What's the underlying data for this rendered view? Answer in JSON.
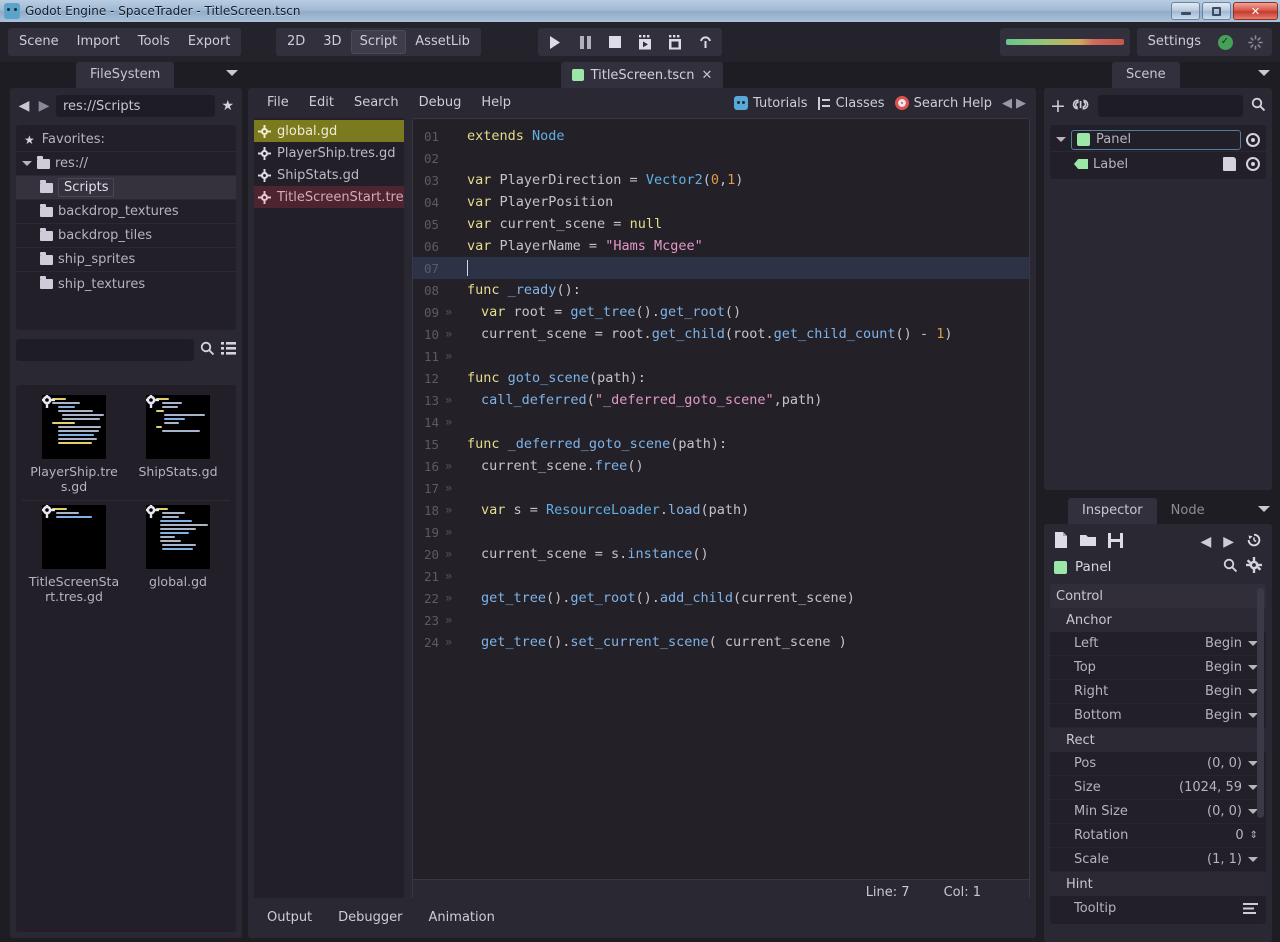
{
  "window": {
    "title": "Godot Engine - SpaceTrader - TitleScreen.tscn",
    "minimize_label": "Minimize",
    "restore_label": "Restore",
    "close_label": "✕"
  },
  "topbar": {
    "main_menu": [
      "Scene",
      "Import",
      "Tools",
      "Export"
    ],
    "mode_tabs": [
      {
        "label": "2D",
        "active": false
      },
      {
        "label": "3D",
        "active": false
      },
      {
        "label": "Script",
        "active": true
      },
      {
        "label": "AssetLib",
        "active": false
      }
    ],
    "playback": [
      {
        "name": "play-icon",
        "glyph": "▶"
      },
      {
        "name": "pause-icon",
        "glyph": "❙❙"
      },
      {
        "name": "stop-icon",
        "glyph": "■"
      },
      {
        "name": "play-scene-icon",
        "glyph": "▶"
      },
      {
        "name": "play-custom-scene-icon",
        "glyph": "▣"
      },
      {
        "name": "remote-debug-icon",
        "glyph": "⌖"
      }
    ],
    "settings_label": "Settings",
    "settings_status_glyph": "✓",
    "progress_colors": [
      "#68c68e",
      "#d1a95c",
      "#c5564b"
    ]
  },
  "filesystem": {
    "dock_title": "FileSystem",
    "path_value": "res://Scripts",
    "nav_back_glyph": "◀",
    "nav_forward_glyph": "▶",
    "favorite_glyph": "★",
    "tree": [
      {
        "label": "Favorites:",
        "kind": "favorites",
        "depth": 0
      },
      {
        "label": "res://",
        "kind": "folder",
        "depth": 0,
        "expanded": true
      },
      {
        "label": "Scripts",
        "kind": "folder",
        "depth": 1,
        "selected": true
      },
      {
        "label": "backdrop_textures",
        "kind": "folder",
        "depth": 1
      },
      {
        "label": "backdrop_tiles",
        "kind": "folder",
        "depth": 1
      },
      {
        "label": "ship_sprites",
        "kind": "folder",
        "depth": 1
      },
      {
        "label": "ship_textures",
        "kind": "folder",
        "depth": 1
      }
    ],
    "search_placeholder": "",
    "search_value": "",
    "files": [
      {
        "label": "PlayerShip.tres.gd"
      },
      {
        "label": "ShipStats.gd"
      },
      {
        "label": "TitleScreenStart.tres.gd"
      },
      {
        "label": "global.gd"
      }
    ]
  },
  "editor": {
    "scene_tab": {
      "label": "TitleScreen.tscn",
      "close_glyph": "✕"
    },
    "menu": [
      "File",
      "Edit",
      "Search",
      "Debug",
      "Help"
    ],
    "help_links": [
      {
        "label": "Tutorials",
        "icon": "godot-head-icon"
      },
      {
        "label": "Classes",
        "icon": "class-tree-icon"
      },
      {
        "label": "Search Help",
        "icon": "lifebuoy-icon"
      }
    ],
    "nav_prev_glyph": "◀",
    "nav_next_glyph": "▶",
    "script_list": [
      {
        "label": "global.gd",
        "state": "selected"
      },
      {
        "label": "PlayerShip.tres.gd",
        "state": "normal"
      },
      {
        "label": "ShipStats.gd",
        "state": "normal"
      },
      {
        "label": "TitleScreenStart.tre",
        "state": "error"
      }
    ],
    "status": {
      "line_label": "Line: 7",
      "col_label": "Col: 1"
    },
    "code": [
      {
        "n": "01",
        "tab": false,
        "cur": false,
        "tokens": [
          {
            "t": "extends",
            "c": "k-kw"
          },
          {
            "t": " ",
            "c": "k-plain"
          },
          {
            "t": "Node",
            "c": "k-type"
          }
        ]
      },
      {
        "n": "02",
        "tab": false,
        "cur": false,
        "tokens": []
      },
      {
        "n": "03",
        "tab": false,
        "cur": false,
        "tokens": [
          {
            "t": "var",
            "c": "k-kw"
          },
          {
            "t": " PlayerDirection = ",
            "c": "k-plain"
          },
          {
            "t": "Vector2",
            "c": "k-type"
          },
          {
            "t": "(",
            "c": "k-punct"
          },
          {
            "t": "0",
            "c": "k-num"
          },
          {
            "t": ",",
            "c": "k-punct"
          },
          {
            "t": "1",
            "c": "k-num"
          },
          {
            "t": ")",
            "c": "k-punct"
          }
        ]
      },
      {
        "n": "04",
        "tab": false,
        "cur": false,
        "tokens": [
          {
            "t": "var",
            "c": "k-kw"
          },
          {
            "t": " PlayerPosition",
            "c": "k-plain"
          }
        ]
      },
      {
        "n": "05",
        "tab": false,
        "cur": false,
        "tokens": [
          {
            "t": "var",
            "c": "k-kw"
          },
          {
            "t": " current_scene = ",
            "c": "k-plain"
          },
          {
            "t": "null",
            "c": "k-kw"
          }
        ]
      },
      {
        "n": "06",
        "tab": false,
        "cur": false,
        "tokens": [
          {
            "t": "var",
            "c": "k-kw"
          },
          {
            "t": " PlayerName = ",
            "c": "k-plain"
          },
          {
            "t": "\"Hams Mcgee\"",
            "c": "k-str"
          }
        ]
      },
      {
        "n": "07",
        "tab": false,
        "cur": true,
        "tokens": []
      },
      {
        "n": "08",
        "tab": false,
        "cur": false,
        "tokens": [
          {
            "t": "func",
            "c": "k-kw"
          },
          {
            "t": " ",
            "c": "k-plain"
          },
          {
            "t": "_ready",
            "c": "k-fn"
          },
          {
            "t": "():",
            "c": "k-punct"
          }
        ]
      },
      {
        "n": "09",
        "tab": true,
        "cur": false,
        "tokens": [
          {
            "t": "var",
            "c": "k-kw"
          },
          {
            "t": " root = ",
            "c": "k-plain"
          },
          {
            "t": "get_tree",
            "c": "k-fn"
          },
          {
            "t": "().",
            "c": "k-punct"
          },
          {
            "t": "get_root",
            "c": "k-fn"
          },
          {
            "t": "()",
            "c": "k-punct"
          }
        ]
      },
      {
        "n": "10",
        "tab": true,
        "cur": false,
        "tokens": [
          {
            "t": "current_scene = root.",
            "c": "k-plain"
          },
          {
            "t": "get_child",
            "c": "k-fn"
          },
          {
            "t": "(root.",
            "c": "k-punct"
          },
          {
            "t": "get_child_count",
            "c": "k-fn"
          },
          {
            "t": "() - ",
            "c": "k-punct"
          },
          {
            "t": "1",
            "c": "k-num"
          },
          {
            "t": ")",
            "c": "k-punct"
          }
        ]
      },
      {
        "n": "11",
        "tab": true,
        "cur": false,
        "tokens": []
      },
      {
        "n": "12",
        "tab": false,
        "cur": false,
        "tokens": [
          {
            "t": "func",
            "c": "k-kw"
          },
          {
            "t": " ",
            "c": "k-plain"
          },
          {
            "t": "goto_scene",
            "c": "k-fn"
          },
          {
            "t": "(path):",
            "c": "k-punct"
          }
        ]
      },
      {
        "n": "13",
        "tab": true,
        "cur": false,
        "tokens": [
          {
            "t": "call_deferred",
            "c": "k-fn"
          },
          {
            "t": "(",
            "c": "k-punct"
          },
          {
            "t": "\"_deferred_goto_scene\"",
            "c": "k-str"
          },
          {
            "t": ",path)",
            "c": "k-punct"
          }
        ]
      },
      {
        "n": "14",
        "tab": true,
        "cur": false,
        "tokens": []
      },
      {
        "n": "15",
        "tab": false,
        "cur": false,
        "tokens": [
          {
            "t": "func",
            "c": "k-kw"
          },
          {
            "t": " ",
            "c": "k-plain"
          },
          {
            "t": "_deferred_goto_scene",
            "c": "k-fn"
          },
          {
            "t": "(path):",
            "c": "k-punct"
          }
        ]
      },
      {
        "n": "16",
        "tab": true,
        "cur": false,
        "tokens": [
          {
            "t": "current_scene.",
            "c": "k-plain"
          },
          {
            "t": "free",
            "c": "k-fn"
          },
          {
            "t": "()",
            "c": "k-punct"
          }
        ]
      },
      {
        "n": "17",
        "tab": true,
        "cur": false,
        "tokens": []
      },
      {
        "n": "18",
        "tab": true,
        "cur": false,
        "tokens": [
          {
            "t": "var",
            "c": "k-kw"
          },
          {
            "t": " s = ",
            "c": "k-plain"
          },
          {
            "t": "ResourceLoader",
            "c": "k-type"
          },
          {
            "t": ".",
            "c": "k-punct"
          },
          {
            "t": "load",
            "c": "k-fn"
          },
          {
            "t": "(path)",
            "c": "k-punct"
          }
        ]
      },
      {
        "n": "19",
        "tab": true,
        "cur": false,
        "tokens": []
      },
      {
        "n": "20",
        "tab": true,
        "cur": false,
        "tokens": [
          {
            "t": "current_scene = s.",
            "c": "k-plain"
          },
          {
            "t": "instance",
            "c": "k-fn"
          },
          {
            "t": "()",
            "c": "k-punct"
          }
        ]
      },
      {
        "n": "21",
        "tab": true,
        "cur": false,
        "tokens": []
      },
      {
        "n": "22",
        "tab": true,
        "cur": false,
        "tokens": [
          {
            "t": "get_tree",
            "c": "k-fn"
          },
          {
            "t": "().",
            "c": "k-punct"
          },
          {
            "t": "get_root",
            "c": "k-fn"
          },
          {
            "t": "().",
            "c": "k-punct"
          },
          {
            "t": "add_child",
            "c": "k-fn"
          },
          {
            "t": "(current_scene)",
            "c": "k-punct"
          }
        ]
      },
      {
        "n": "23",
        "tab": true,
        "cur": false,
        "tokens": []
      },
      {
        "n": "24",
        "tab": true,
        "cur": false,
        "tokens": [
          {
            "t": "get_tree",
            "c": "k-fn"
          },
          {
            "t": "().",
            "c": "k-punct"
          },
          {
            "t": "set_current_scene",
            "c": "k-fn"
          },
          {
            "t": "( current_scene )",
            "c": "k-punct"
          }
        ]
      }
    ]
  },
  "bottom_panel": {
    "tabs": [
      "Output",
      "Debugger",
      "Animation"
    ]
  },
  "scene_dock": {
    "title": "Scene",
    "add_glyph": "+",
    "link_glyph": "🔗",
    "filter_value": "",
    "search_glyph": "⌕",
    "nodes": [
      {
        "label": "Panel",
        "icon": "panel-node-icon",
        "selected": true,
        "depth": 0,
        "has_script": false
      },
      {
        "label": "Label",
        "icon": "label-node-icon",
        "selected": false,
        "depth": 1,
        "has_script": true
      }
    ]
  },
  "inspector": {
    "tabs": [
      {
        "label": "Inspector",
        "active": true
      },
      {
        "label": "Node",
        "active": false
      }
    ],
    "toolbar": [
      {
        "name": "new-resource-icon",
        "glyph": "🗋"
      },
      {
        "name": "open-resource-icon",
        "glyph": "🗀"
      },
      {
        "name": "save-resource-icon",
        "glyph": "🖫"
      },
      {
        "name": "history-prev-icon",
        "glyph": "◀"
      },
      {
        "name": "history-next-icon",
        "glyph": "▶"
      },
      {
        "name": "history-icon",
        "glyph": "↺"
      }
    ],
    "object_name": "Panel",
    "search_glyph": "⌕",
    "settings_glyph": "⚙",
    "properties": [
      {
        "kind": "category",
        "label": "Control"
      },
      {
        "kind": "subcategory",
        "label": "Anchor"
      },
      {
        "kind": "row",
        "label": "Left",
        "value": "Begin",
        "control": "dropdown"
      },
      {
        "kind": "row",
        "label": "Top",
        "value": "Begin",
        "control": "dropdown"
      },
      {
        "kind": "row",
        "label": "Right",
        "value": "Begin",
        "control": "dropdown"
      },
      {
        "kind": "row",
        "label": "Bottom",
        "value": "Begin",
        "control": "dropdown"
      },
      {
        "kind": "subcategory",
        "label": "Rect"
      },
      {
        "kind": "row",
        "label": "Pos",
        "value": "(0, 0)",
        "control": "dropdown"
      },
      {
        "kind": "row",
        "label": "Size",
        "value": "(1024, 59",
        "control": "dropdown"
      },
      {
        "kind": "row",
        "label": "Min Size",
        "value": "(0, 0)",
        "control": "dropdown"
      },
      {
        "kind": "row",
        "label": "Rotation",
        "value": "0",
        "control": "spinner"
      },
      {
        "kind": "row",
        "label": "Scale",
        "value": "(1, 1)",
        "control": "dropdown"
      },
      {
        "kind": "subcategory",
        "label": "Hint"
      },
      {
        "kind": "row",
        "label": "Tooltip",
        "value": "",
        "control": "textlines"
      }
    ]
  }
}
